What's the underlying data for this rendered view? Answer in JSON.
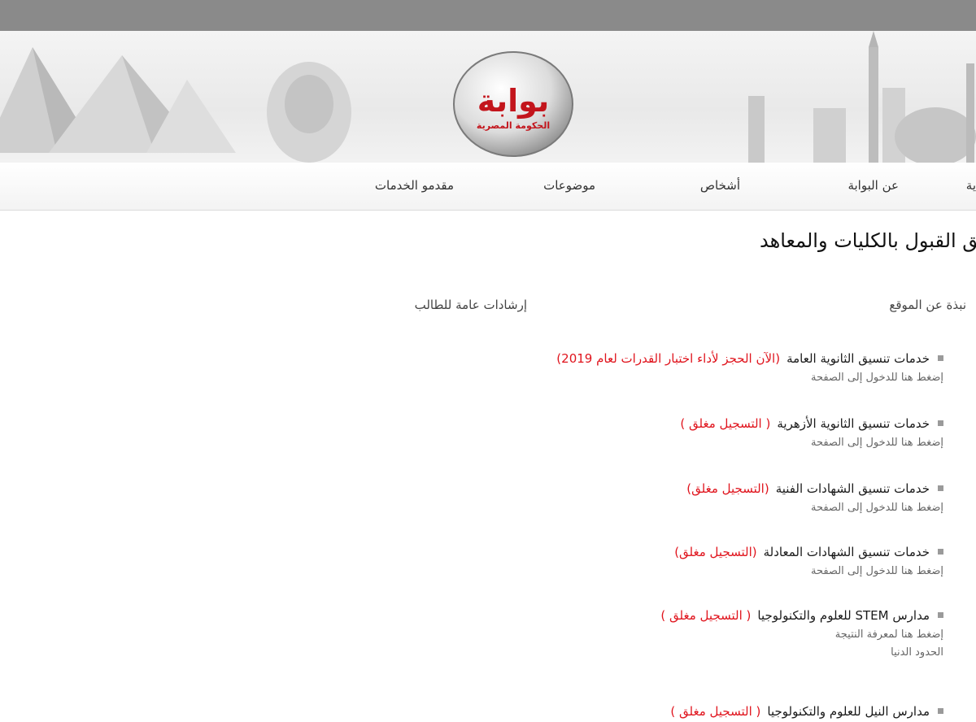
{
  "logo": {
    "main": "بوابة",
    "sub": "الحكومة المصرية"
  },
  "nav": {
    "items": [
      {
        "id": "home",
        "label": "ية"
      },
      {
        "id": "about",
        "label": "عن البوابة"
      },
      {
        "id": "people",
        "label": "أشخاص"
      },
      {
        "id": "topics",
        "label": "موضوعات"
      },
      {
        "id": "providers",
        "label": "مقدمو الخدمات"
      }
    ]
  },
  "page": {
    "title": "يق القبول بالكليات والمعاهد"
  },
  "subnav": {
    "about_site": "نبذة عن الموقع",
    "guidance": "إرشادات عامة للطالب"
  },
  "services": [
    {
      "title": "خدمات تنسيق الثانوية العامة",
      "status": "(الآن الحجز لأداء اختبار القدرات لعام 2019)",
      "links": [
        "إضغط هنا للدخول إلى الصفحة"
      ]
    },
    {
      "title": "خدمات تنسيق الثانوية الأزهرية",
      "status": "( التسجيل مغلق )",
      "links": [
        "إضغط هنا للدخول إلى الصفحة"
      ]
    },
    {
      "title": "خدمات تنسيق الشهادات الفنية",
      "status": "(التسجيل مغلق)",
      "links": [
        "إضغط هنا للدخول إلى الصفحة"
      ]
    },
    {
      "title": "خدمات تنسيق الشهادات المعادلة",
      "status": "(التسجيل مغلق)",
      "links": [
        "إضغط هنا للدخول إلى الصفحة"
      ]
    },
    {
      "title": "مدارس STEM للعلوم والتكنولوجيا",
      "status": "( التسجيل مغلق )",
      "links": [
        "إضغط هنا لمعرفة النتيجة",
        "الحدود الدنيا"
      ]
    },
    {
      "title": "مدارس النيل للعلوم والتكنولوجيا",
      "status": "( التسجيل مغلق )",
      "links": []
    }
  ],
  "colors": {
    "accent_red": "#e0141d",
    "logo_red": "#c3151c",
    "topbar": "#8a8a8a"
  }
}
